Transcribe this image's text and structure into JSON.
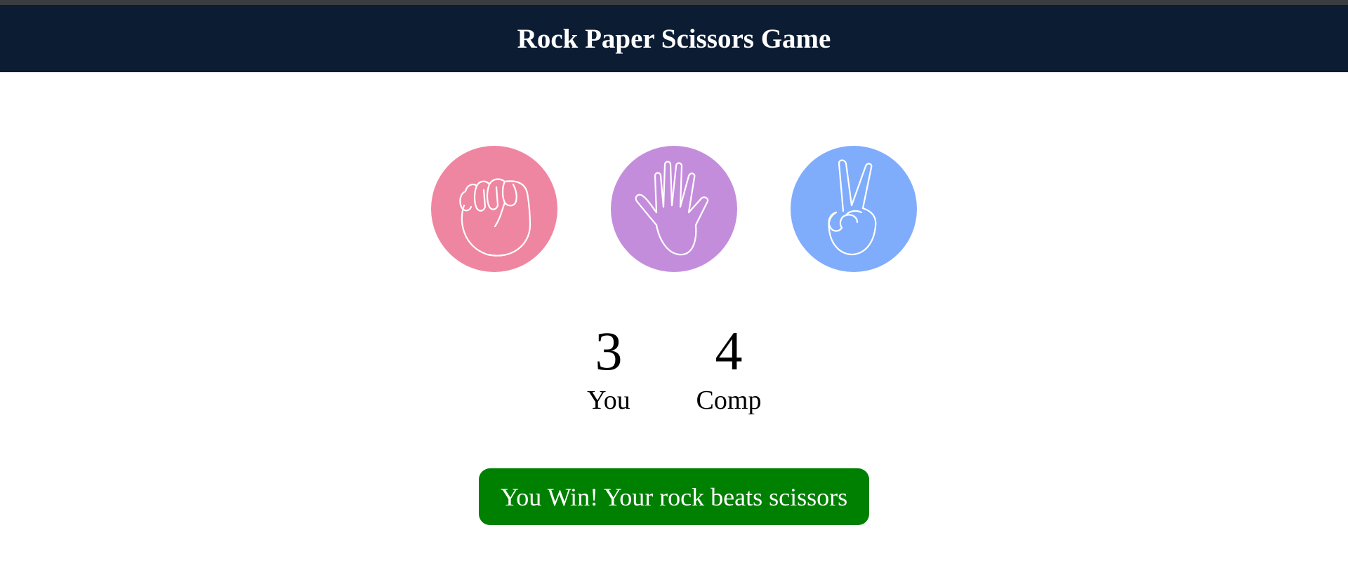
{
  "header": {
    "title": "Rock Paper Scissors Game",
    "background": "#0b1c33"
  },
  "choices": [
    {
      "id": "rock",
      "icon": "rock-fist-icon",
      "color": "#ef86a1"
    },
    {
      "id": "paper",
      "icon": "paper-hand-icon",
      "color": "#c48ddc"
    },
    {
      "id": "scissors",
      "icon": "scissors-hand-icon",
      "color": "#80acfc"
    }
  ],
  "scoreboard": {
    "user": {
      "score": "3",
      "label": "You"
    },
    "computer": {
      "score": "4",
      "label": "Comp"
    }
  },
  "message": {
    "text": "You Win! Your rock beats scissors",
    "color": "#008000"
  }
}
